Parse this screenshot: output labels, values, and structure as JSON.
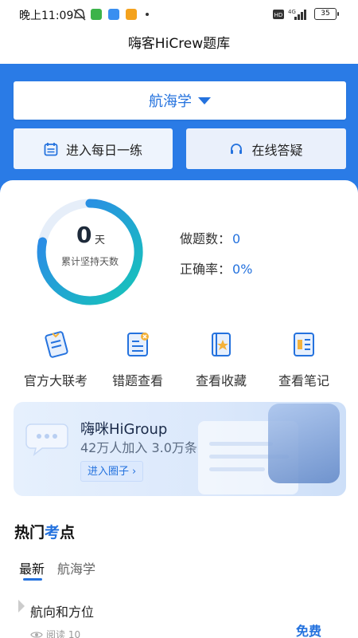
{
  "status_bar": {
    "time": "晚上11:09",
    "network": "4G",
    "battery": "35"
  },
  "header": {
    "title": "嗨客HiCrew题库"
  },
  "subject_selector": {
    "label": "航海学"
  },
  "actions": {
    "daily_practice": "进入每日一练",
    "online_qa": "在线答疑"
  },
  "progress": {
    "days": "0",
    "days_unit": "天",
    "days_caption": "累计坚持天数",
    "questions_label": "做题数：",
    "questions_value": "0",
    "accuracy_label": "正确率：",
    "accuracy_value": "0%"
  },
  "features": [
    {
      "label": "官方大联考",
      "icon": "exam-icon"
    },
    {
      "label": "错题查看",
      "icon": "wrong-questions-icon"
    },
    {
      "label": "查看收藏",
      "icon": "favorites-icon"
    },
    {
      "label": "查看笔记",
      "icon": "notes-icon"
    }
  ],
  "group_banner": {
    "title": "嗨咪HiGroup",
    "stats": "42万人加入 3.0万条",
    "button": "进入圈子"
  },
  "hot_topics": {
    "title_part1": "热门",
    "title_highlight": "考",
    "title_part2": "点",
    "tabs": [
      "最新",
      "航海学"
    ],
    "items": [
      {
        "title": "航向和方位",
        "reads": "阅读 10",
        "price": "免费"
      }
    ]
  },
  "colors": {
    "primary": "#2a7be6",
    "accent_text": "#2472de",
    "ring_start": "#2f7ff0",
    "ring_end": "#16c6b8"
  }
}
